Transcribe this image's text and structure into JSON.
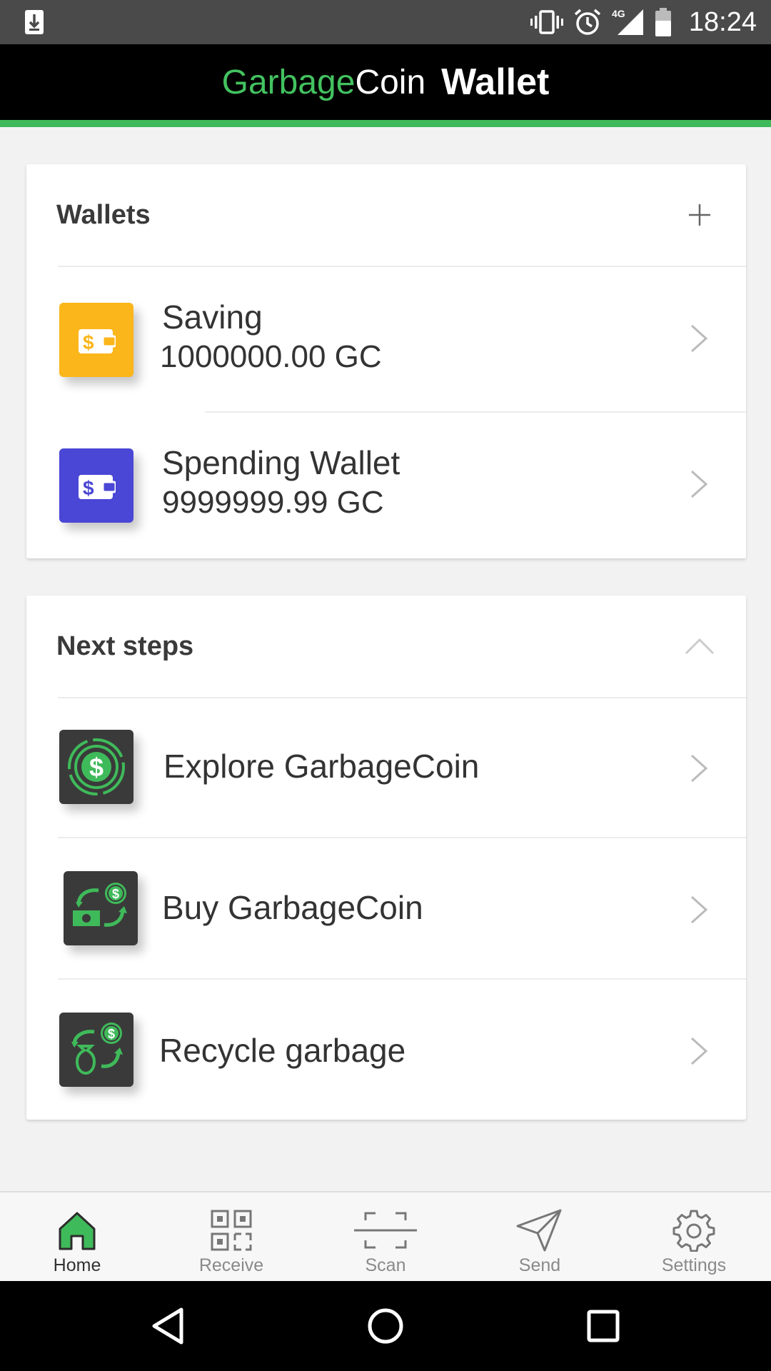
{
  "status_bar": {
    "time": "18:24",
    "network": "4G"
  },
  "header": {
    "brand_part1": "Garbage",
    "brand_part2": "Coin",
    "title": "Wallet",
    "accent_color": "#3fba5a"
  },
  "wallets": {
    "title": "Wallets",
    "items": [
      {
        "name": "Saving",
        "balance": "1000000.00 GC",
        "icon": "wallet-icon",
        "color": "#fbb61b"
      },
      {
        "name": "Spending Wallet",
        "balance": "9999999.99 GC",
        "icon": "wallet-icon",
        "color": "#4a46d6"
      }
    ]
  },
  "next_steps": {
    "title": "Next steps",
    "items": [
      {
        "label": "Explore GarbageCoin",
        "icon": "coin-explore-icon"
      },
      {
        "label": "Buy GarbageCoin",
        "icon": "buy-exchange-icon"
      },
      {
        "label": "Recycle garbage",
        "icon": "recycle-bag-icon"
      }
    ]
  },
  "bottom_nav": {
    "items": [
      {
        "label": "Home",
        "icon": "home-icon",
        "active": true
      },
      {
        "label": "Receive",
        "icon": "qr-code-icon"
      },
      {
        "label": "Scan",
        "icon": "scan-icon"
      },
      {
        "label": "Send",
        "icon": "paper-plane-icon"
      },
      {
        "label": "Settings",
        "icon": "gear-icon"
      }
    ]
  }
}
